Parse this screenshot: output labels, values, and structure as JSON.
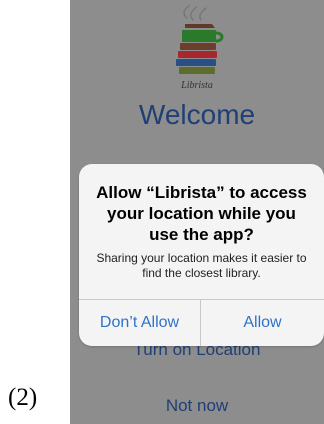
{
  "figure_label": "(2)",
  "screen": {
    "logo_text": "Librista",
    "welcome": "Welcome",
    "turn_on_location": "Turn on Location",
    "not_now": "Not now"
  },
  "alert": {
    "title": "Allow “Librista” to access your location while you use the app?",
    "message": "Sharing your location makes it easier to find the closest library.",
    "dont_allow": "Don’t Allow",
    "allow": "Allow"
  },
  "colors": {
    "background": "#ffffff",
    "dimmed_screen": "#8d8d8d",
    "primary_text": "#1f3f75",
    "alert_background": "#f4f4f4",
    "alert_button": "#2f73c7"
  },
  "icons": {
    "logo": "book-stack-cup-logo"
  }
}
